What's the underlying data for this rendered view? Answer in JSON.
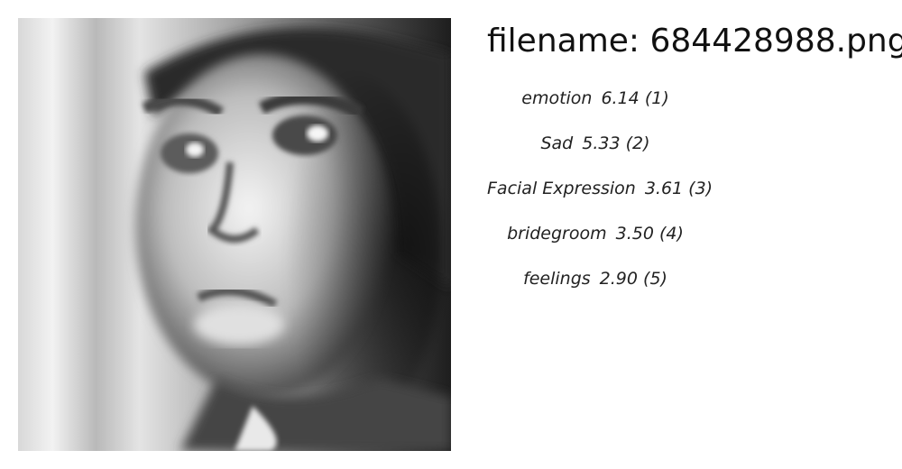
{
  "filename_prefix": "filename: ",
  "filename": "684428988.png",
  "predictions": [
    {
      "label": "emotion",
      "score": "6.14",
      "rank": "(1)"
    },
    {
      "label": "Sad",
      "score": "5.33",
      "rank": "(2)"
    },
    {
      "label": "Facial Expression",
      "score": "3.61",
      "rank": "(3)"
    },
    {
      "label": "bridegroom",
      "score": "3.50",
      "rank": "(4)"
    },
    {
      "label": "feelings",
      "score": "2.90",
      "rank": "(5)"
    }
  ]
}
